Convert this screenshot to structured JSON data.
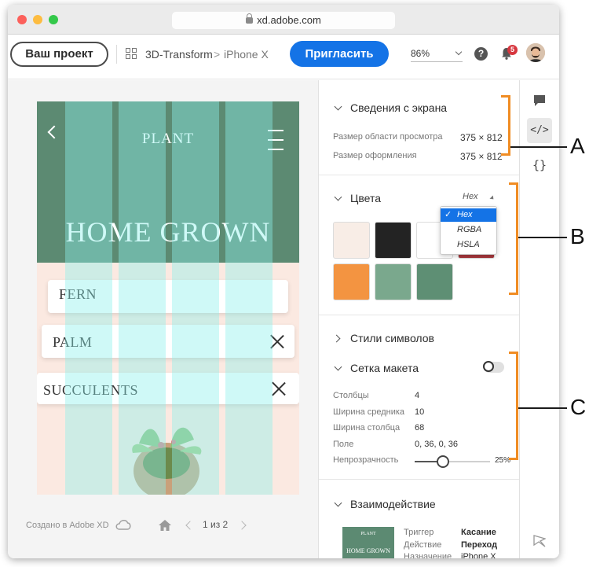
{
  "browser": {
    "url": "xd.adobe.com",
    "traffic_colors": [
      "#fc605b",
      "#fdbc40",
      "#34c84a"
    ]
  },
  "toolbar": {
    "project_label": "Ваш проект",
    "breadcrumb_doc": "3D-Transform",
    "breadcrumb_sep": ">",
    "breadcrumb_artboard": "iPhone X",
    "invite_label": "Пригласить",
    "zoom_value": "86%",
    "help_glyph": "?",
    "notifications_count": "5",
    "accent_color": "#1473e6"
  },
  "artboard": {
    "logo": "PLANT",
    "title": "HOME GROWN",
    "cards": [
      {
        "label": "FERN"
      },
      {
        "label": "PALM"
      },
      {
        "label": "SUCCULENTS"
      }
    ],
    "overlay_color": "rgba(140, 240, 235, 0.42)"
  },
  "canvas_footer": {
    "made_with": "Создано в Adobe XD",
    "page_indicator": "1 из 2"
  },
  "inspect": {
    "screen_info": {
      "heading": "Сведения с экрана",
      "viewport_label": "Размер области просмотра",
      "viewport_value": "375 × 812",
      "design_label": "Размер оформления",
      "design_value": "375 × 812"
    },
    "colors": {
      "heading": "Цвета",
      "format_selected": "Hex",
      "format_options": [
        "Hex",
        "RGBA",
        "HSLA"
      ],
      "swatches": [
        "#f8ede6",
        "#232323",
        "#ffffff",
        "#a8383d",
        "#f39441",
        "#7aa88d",
        "#5e8f74"
      ]
    },
    "char_styles": {
      "heading": "Стили символов"
    },
    "layout_grid": {
      "heading": "Сетка макета",
      "enabled": false,
      "rows": [
        {
          "label": "Столбцы",
          "value": "4"
        },
        {
          "label": "Ширина средника",
          "value": "10"
        },
        {
          "label": "Ширина столбца",
          "value": "68"
        },
        {
          "label": "Поле",
          "value": "0, 36, 0, 36"
        },
        {
          "label": "Непрозрачность",
          "value": "25%"
        }
      ],
      "opacity_level": 0.38
    },
    "interaction": {
      "heading": "Взаимодействие",
      "thumb_logo": "PLANT",
      "thumb_title": "HOME GROWN",
      "rows": [
        {
          "label": "Триггер",
          "value": "Касание"
        },
        {
          "label": "Действие",
          "value": "Переход"
        },
        {
          "label": "Назначение",
          "value": "iPhone X"
        }
      ]
    }
  },
  "rail": {
    "code_glyph": "</>",
    "braces_glyph": "{}"
  },
  "annotations": {
    "labels": [
      "A",
      "B",
      "C"
    ],
    "bracket_color": "#f08c23"
  }
}
